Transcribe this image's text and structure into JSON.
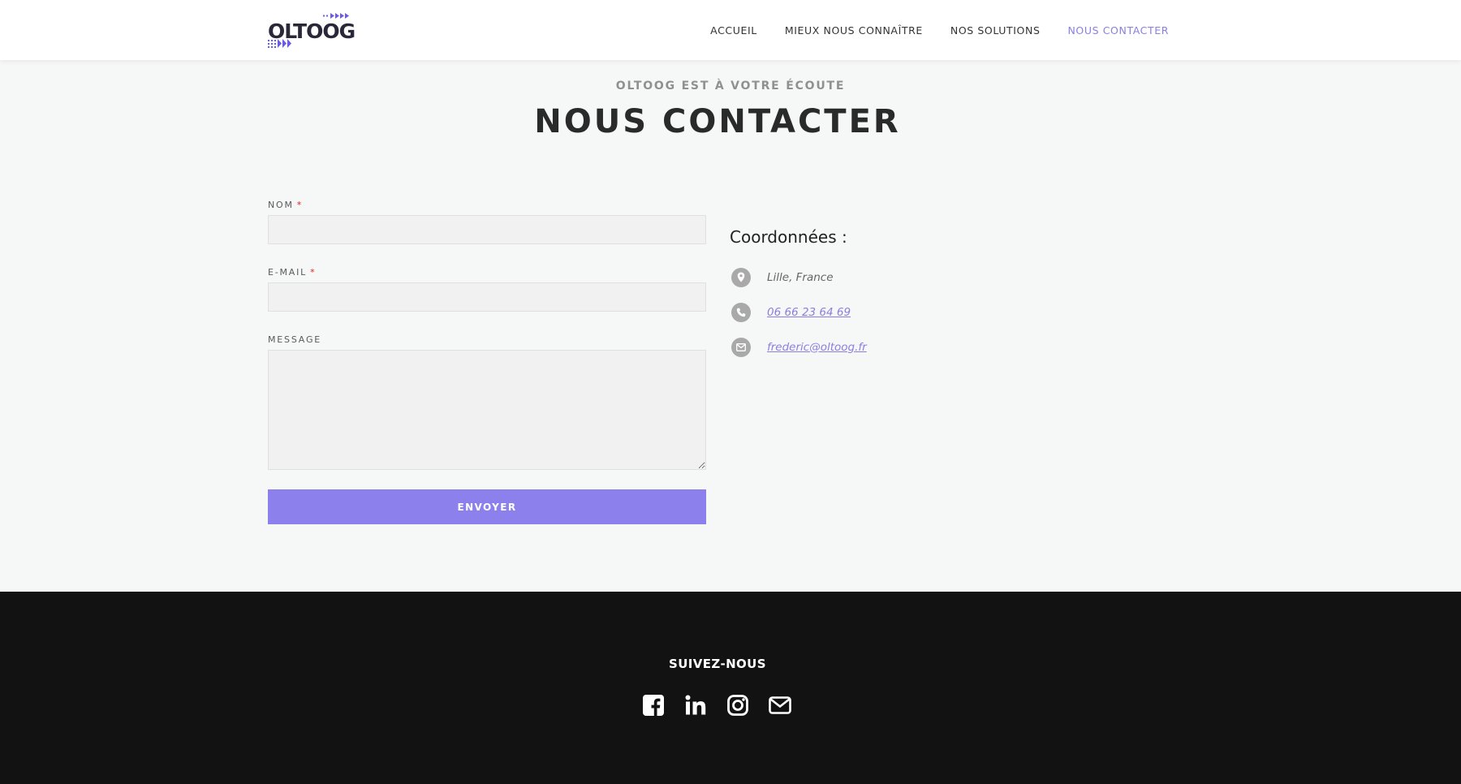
{
  "brand": {
    "logo_text": "OLTOOG",
    "accent_color": "#8b80ec"
  },
  "nav": {
    "items": [
      {
        "label": "ACCUEIL"
      },
      {
        "label": "MIEUX NOUS CONNAÎTRE"
      },
      {
        "label": "NOS SOLUTIONS"
      },
      {
        "label": "NOUS CONTACTER",
        "active": true
      }
    ]
  },
  "hero": {
    "eyebrow": "OLTOOG EST À VOTRE ÉCOUTE",
    "title": "NOUS CONTACTER"
  },
  "form": {
    "name_label": "NOM",
    "email_label": "E-MAIL",
    "message_label": "MESSAGE",
    "required_mark": "*",
    "name_value": "",
    "email_value": "",
    "message_value": "",
    "submit_label": "ENVOYER"
  },
  "contact": {
    "heading": "Coordonnées :",
    "items": [
      {
        "icon": "location-pin-icon",
        "text": "Lille, France"
      },
      {
        "icon": "phone-icon",
        "text": "06 66 23 64 69"
      },
      {
        "icon": "envelope-icon",
        "text": "frederic@oltoog.fr"
      }
    ]
  },
  "footer": {
    "follow_label": "SUIVEZ-NOUS",
    "socials": [
      "facebook-icon",
      "linkedin-icon",
      "instagram-icon",
      "email-icon"
    ]
  }
}
